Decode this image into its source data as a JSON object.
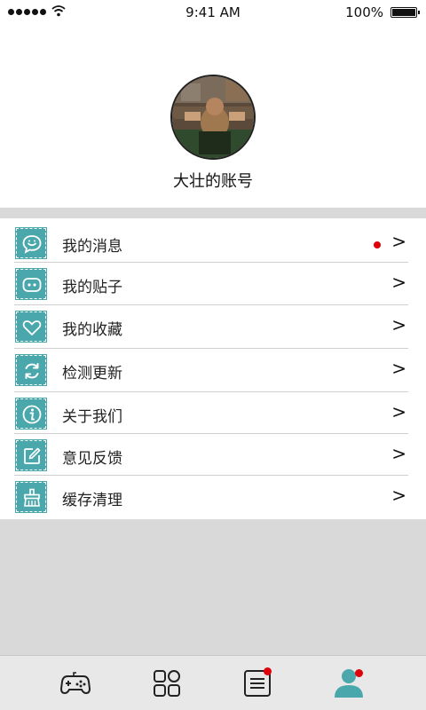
{
  "status_bar": {
    "time": "9:41 AM",
    "battery": "100%"
  },
  "profile": {
    "account_name": "大壮的账号"
  },
  "menu": {
    "items": [
      {
        "label": "我的消息",
        "icon": "message-smile-icon",
        "has_badge": true
      },
      {
        "label": "我的贴子",
        "icon": "posts-icon",
        "has_badge": false
      },
      {
        "label": "我的收藏",
        "icon": "heart-icon",
        "has_badge": false
      },
      {
        "label": "检测更新",
        "icon": "refresh-icon",
        "has_badge": false
      },
      {
        "label": "关于我们",
        "icon": "info-icon",
        "has_badge": false
      },
      {
        "label": "意见反馈",
        "icon": "edit-icon",
        "has_badge": false
      },
      {
        "label": "缓存清理",
        "icon": "broom-icon",
        "has_badge": false
      }
    ],
    "chevron": ">"
  },
  "tab_bar": {
    "tabs": [
      {
        "icon": "gamepad-icon",
        "active": false,
        "badge": false
      },
      {
        "icon": "apps-grid-icon",
        "active": false,
        "badge": false
      },
      {
        "icon": "news-list-icon",
        "active": false,
        "badge": true
      },
      {
        "icon": "user-icon",
        "active": true,
        "badge": true
      }
    ]
  },
  "colors": {
    "accent": "#4aa7ac",
    "badge": "#e0000c",
    "band": "#d9d9d9"
  }
}
